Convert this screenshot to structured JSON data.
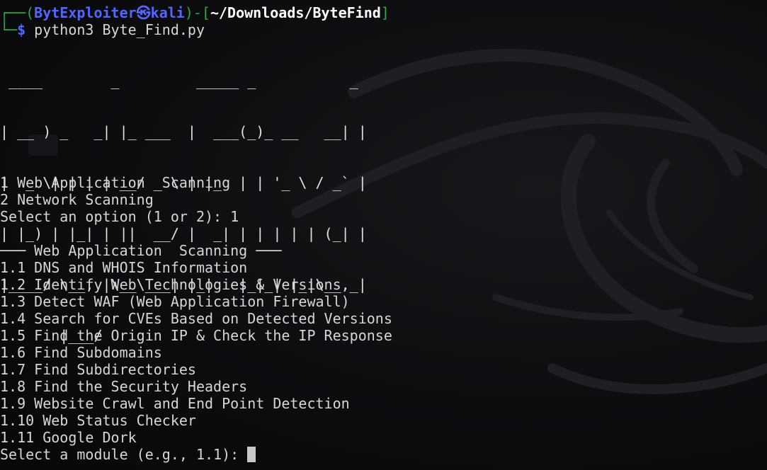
{
  "prompt": {
    "frame_open": "┌──(",
    "user_host": "BytExploiter㉿kali",
    "frame_mid": ")-[",
    "path": "~/Downloads/ByteFind",
    "frame_close": "]",
    "frame_bottom": "└─",
    "dollar": "$",
    "command": " python3 Byte_Find.py"
  },
  "banner": {
    "lines": [
      " ____        _         _____ _           _ ",
      "| __ ) _   _| |_ ___  |  ___(_)_ __   __| |",
      "|  _ \\| | | | __/ _ \\ | |_  | | '_ \\ / _` |",
      "| |_) | |_| | ||  __/ |  _| | | | | | (_| |",
      "|____/ \\__, |\\__\\___| |_|   |_|_| |_|\\__,_|",
      "       |___/"
    ]
  },
  "main_menu": {
    "options": [
      "1 Web Application  Scanning",
      "2 Network Scanning"
    ],
    "select_prompt": "Select an option (1 or 2): ",
    "selected": "1"
  },
  "web_menu": {
    "header": "─── Web Application  Scanning ───",
    "items": [
      "1.1 DNS and WHOIS Information",
      "1.2 Identify Web Technologies & Versions",
      "1.3 Detect WAF (Web Application Firewall)",
      "1.4 Search for CVEs Based on Detected Versions",
      "1.5 Find the Origin IP & Check the IP Response",
      "1.6 Find Subdomains",
      "1.7 Find Subdirectories",
      "1.8 Find the Security Headers",
      "1.9 Website Crawl and End Point Detection",
      "1.10 Web Status Checker",
      "1.11 Google Dork"
    ],
    "select_prompt": "Select a module (e.g., 1.1): "
  },
  "colors": {
    "prompt_frame": "#2aa84a",
    "prompt_user": "#5566ff",
    "prompt_path": "#ffffff",
    "text": "#d6d6d6",
    "background": "#0b0b0d",
    "cursor": "#c8c8c8"
  }
}
